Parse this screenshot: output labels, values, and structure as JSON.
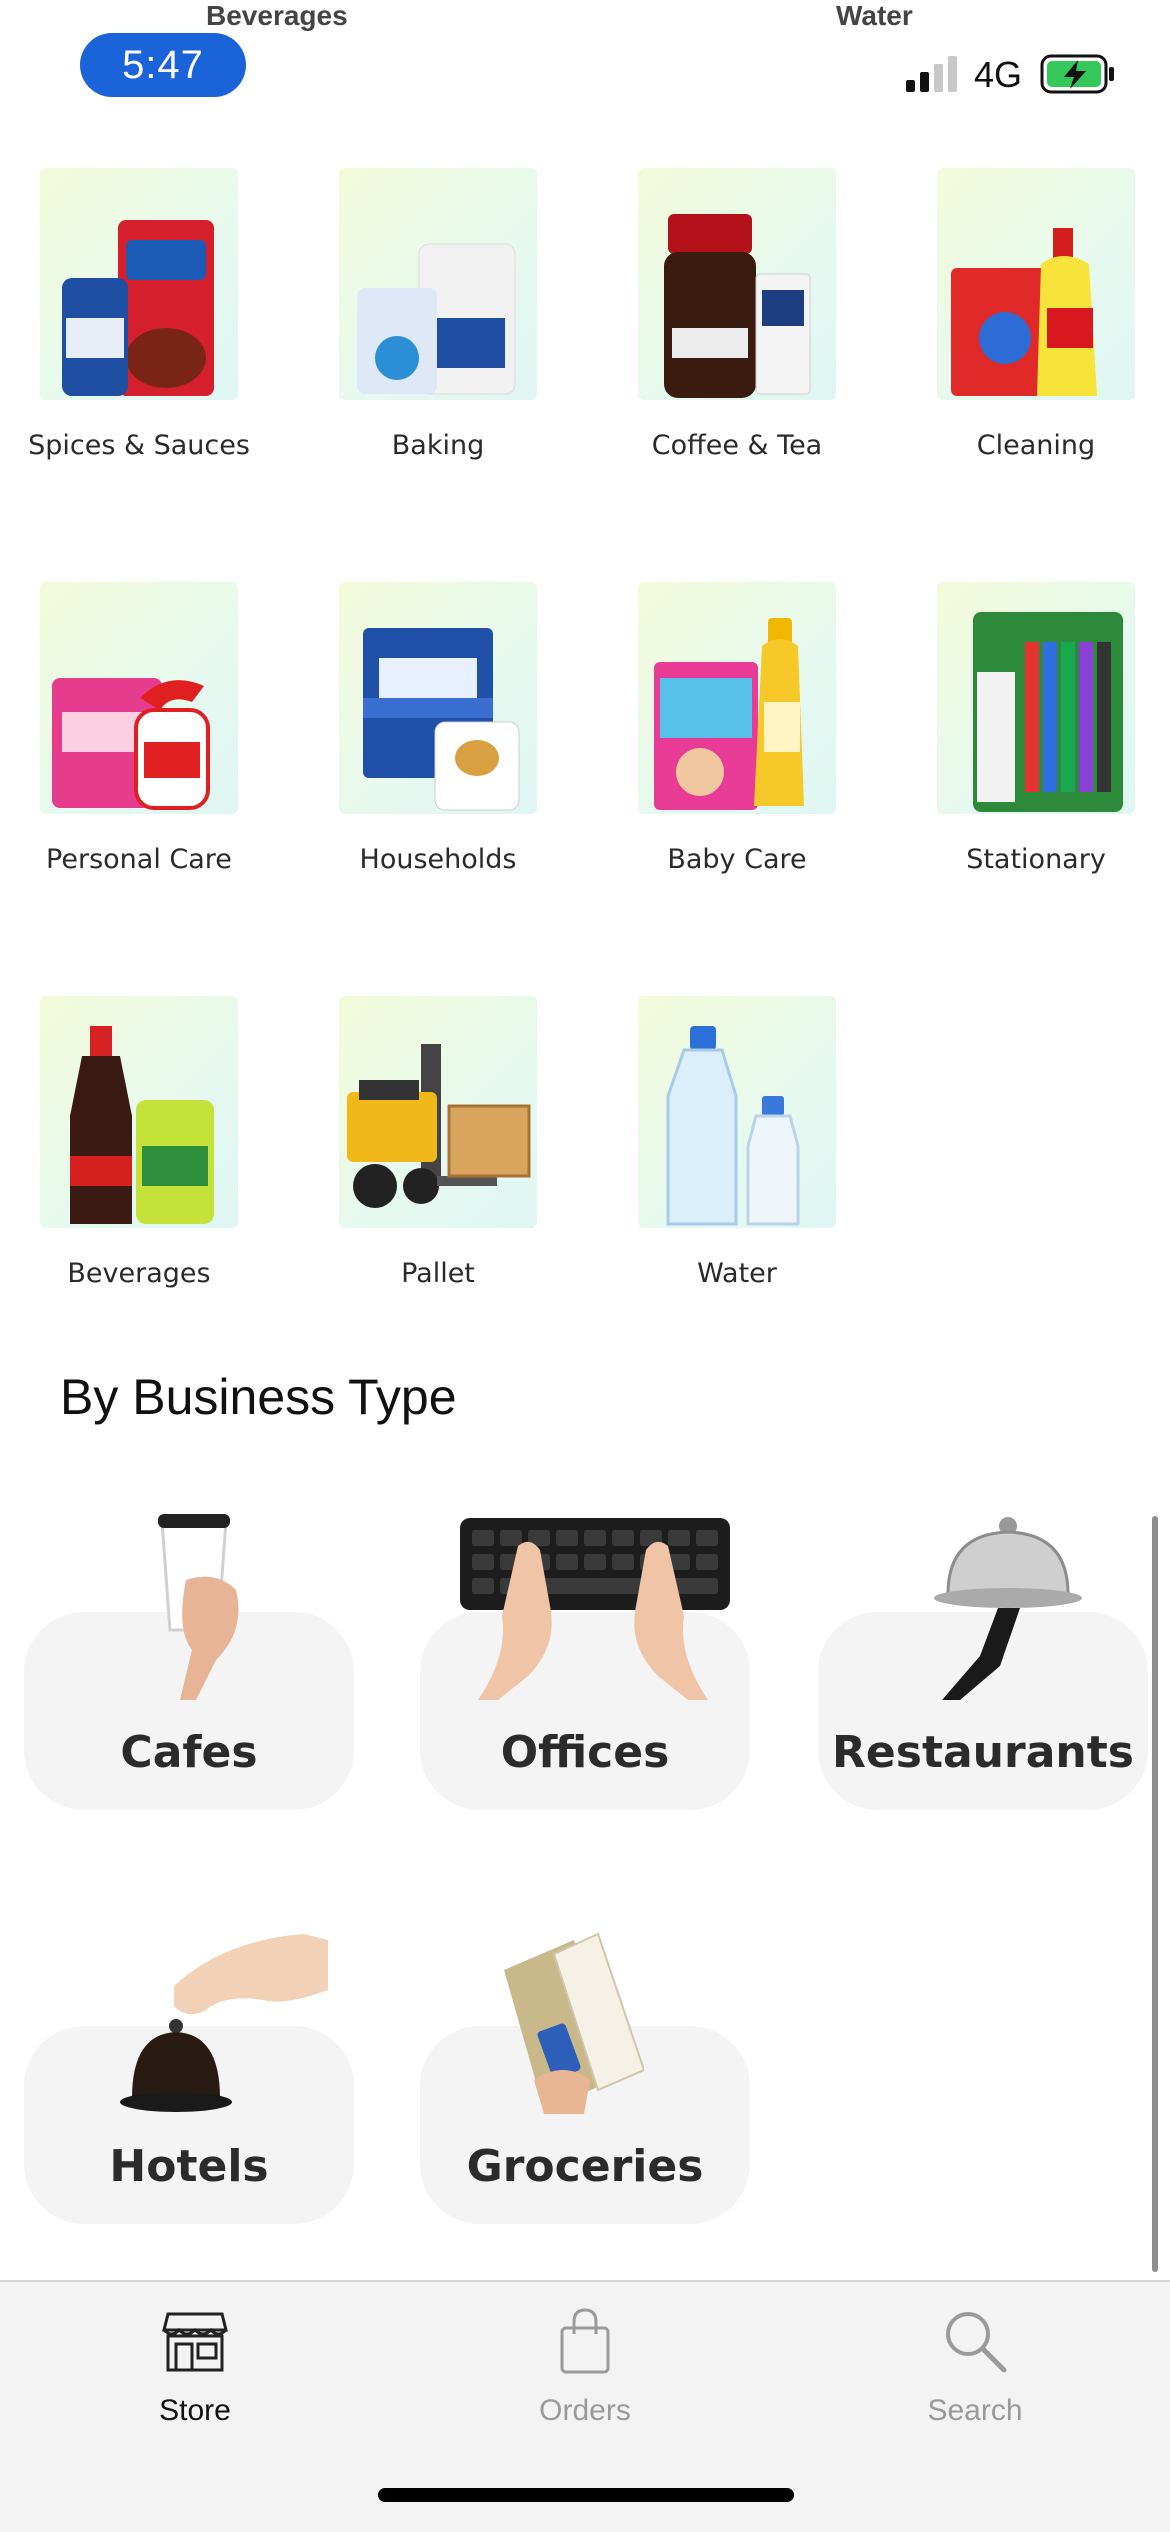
{
  "status_bar": {
    "time": "5:47",
    "network": "4G",
    "peek_labels": [
      "Beverages",
      "Water"
    ]
  },
  "categories": [
    {
      "label": "Spices & Sauces",
      "icon": "spices-sauces-icon"
    },
    {
      "label": "Baking",
      "icon": "baking-icon"
    },
    {
      "label": "Coffee & Tea",
      "icon": "coffee-tea-icon"
    },
    {
      "label": "Cleaning",
      "icon": "cleaning-icon"
    },
    {
      "label": "Personal Care",
      "icon": "personal-care-icon"
    },
    {
      "label": "Households",
      "icon": "households-icon"
    },
    {
      "label": "Baby Care",
      "icon": "baby-care-icon"
    },
    {
      "label": "Stationary",
      "icon": "stationary-icon"
    },
    {
      "label": "Beverages",
      "icon": "beverages-icon"
    },
    {
      "label": "Pallet",
      "icon": "pallet-icon"
    },
    {
      "label": "Water",
      "icon": "water-icon"
    }
  ],
  "business_section": {
    "title": "By Business Type",
    "types": [
      {
        "label": "Cafes",
        "icon": "coffee-cup-icon"
      },
      {
        "label": "Offices",
        "icon": "keyboard-icon"
      },
      {
        "label": "Restaurants",
        "icon": "cloche-icon"
      },
      {
        "label": "Hotels",
        "icon": "service-bell-icon"
      },
      {
        "label": "Groceries",
        "icon": "receipt-icon"
      }
    ]
  },
  "tab_bar": {
    "tabs": [
      {
        "label": "Store",
        "icon": "store-icon",
        "active": true
      },
      {
        "label": "Orders",
        "icon": "shopping-bag-icon",
        "active": false
      },
      {
        "label": "Search",
        "icon": "search-icon",
        "active": false
      }
    ]
  },
  "colors": {
    "time_pill": "#1a63d8",
    "tab_active": "#111111",
    "tab_inactive": "#9a9a9a",
    "card_bg": "#f4f4f4",
    "battery_green": "#34c759"
  }
}
